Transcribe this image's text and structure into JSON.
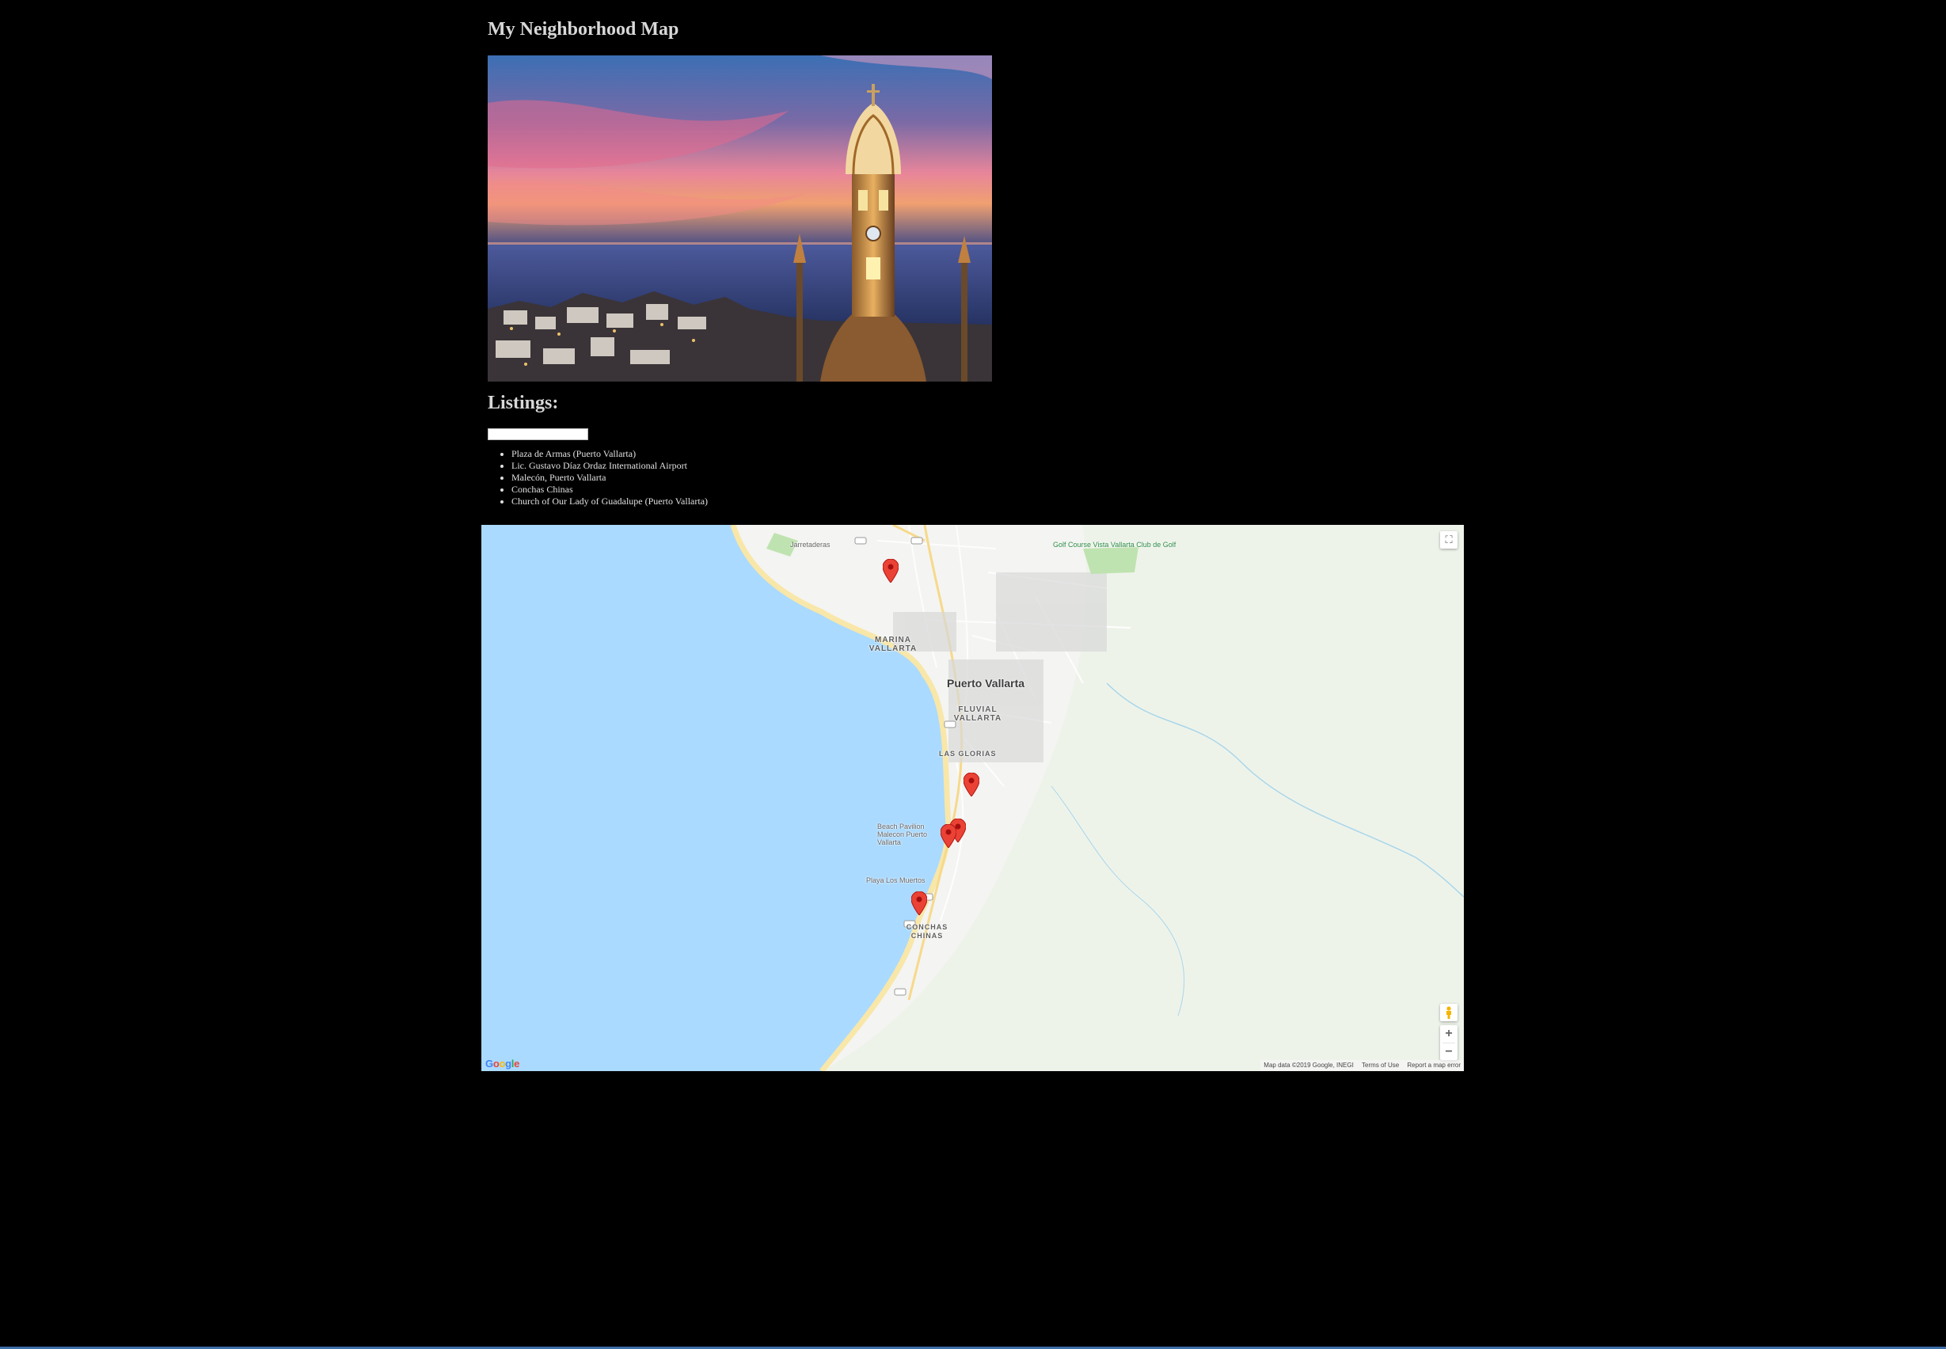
{
  "page": {
    "title": "My Neighborhood Map",
    "listings_heading": "Listings:"
  },
  "hero_image": {
    "subject": "Church of Our Lady of Guadalupe bell tower at sunset over the bay"
  },
  "filter": {
    "value": "",
    "placeholder": ""
  },
  "listings": [
    "Plaza de Armas (Puerto Vallarta)",
    "Lic. Gustavo Díaz Ordaz International Airport",
    "Malecón, Puerto Vallarta",
    "Conchas Chinas",
    "Church of Our Lady of Guadalupe (Puerto Vallarta)"
  ],
  "map": {
    "labels": {
      "city": "Puerto Vallarta",
      "marina": "MARINA VALLARTA",
      "fluvial": "FLUVIAL VALLARTA",
      "glorias": "LAS GLORIAS",
      "conchas": "CONCHAS CHINAS",
      "jarretaderas": "Jarretaderas",
      "golf": "Golf Course Vista Vallarta Club de Golf",
      "beach": "Beach Pavilion Malecon Puerto Vallarta",
      "muertos": "Playa Los Muertos"
    },
    "controls": {
      "fullscreen_icon": "fullscreen-icon",
      "pegman_icon": "pegman-icon",
      "zoom_in": "+",
      "zoom_out": "−"
    },
    "attribution": {
      "data": "Map data ©2019 Google, INEGI",
      "terms": "Terms of Use",
      "report": "Report a map error"
    },
    "logo": "Google",
    "colors": {
      "water": "#aadaff",
      "land": "#f4f4f2",
      "marker": "#ea4335"
    }
  }
}
